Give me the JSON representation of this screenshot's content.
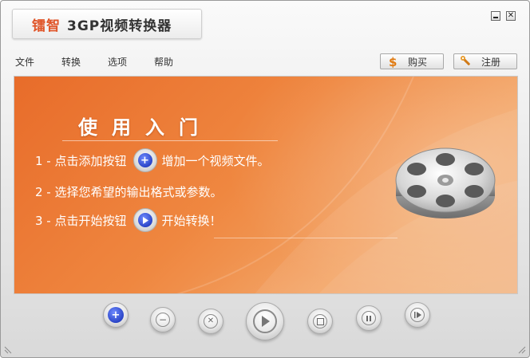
{
  "window": {
    "brand": "镭智",
    "app_name": "3GP视频转换器",
    "controls": {
      "minimize": "minimize-icon",
      "close": "close-icon"
    }
  },
  "menu": [
    "文件",
    "转换",
    "选项",
    "帮助"
  ],
  "toolbar": {
    "buy_label": "购买",
    "buy_icon": "dollar-icon",
    "register_label": "注册",
    "register_icon": "wrench-icon"
  },
  "guide": {
    "title": "使用入门",
    "step1_prefix": "1 - 点击添加按钮",
    "step1_suffix": "增加一个视频文件。",
    "step2": "2 - 选择您希望的输出格式或参数。",
    "step3_prefix": "3 - 点击开始按钮",
    "step3_suffix": "开始转换！",
    "graphic": "film-reel-icon"
  },
  "controls": [
    "add",
    "remove",
    "clear",
    "play",
    "stop",
    "pause",
    "next"
  ],
  "colors": {
    "accent": "#e0562a",
    "panel_orange": "#ef8740",
    "button_blue": "#2b45c7"
  }
}
